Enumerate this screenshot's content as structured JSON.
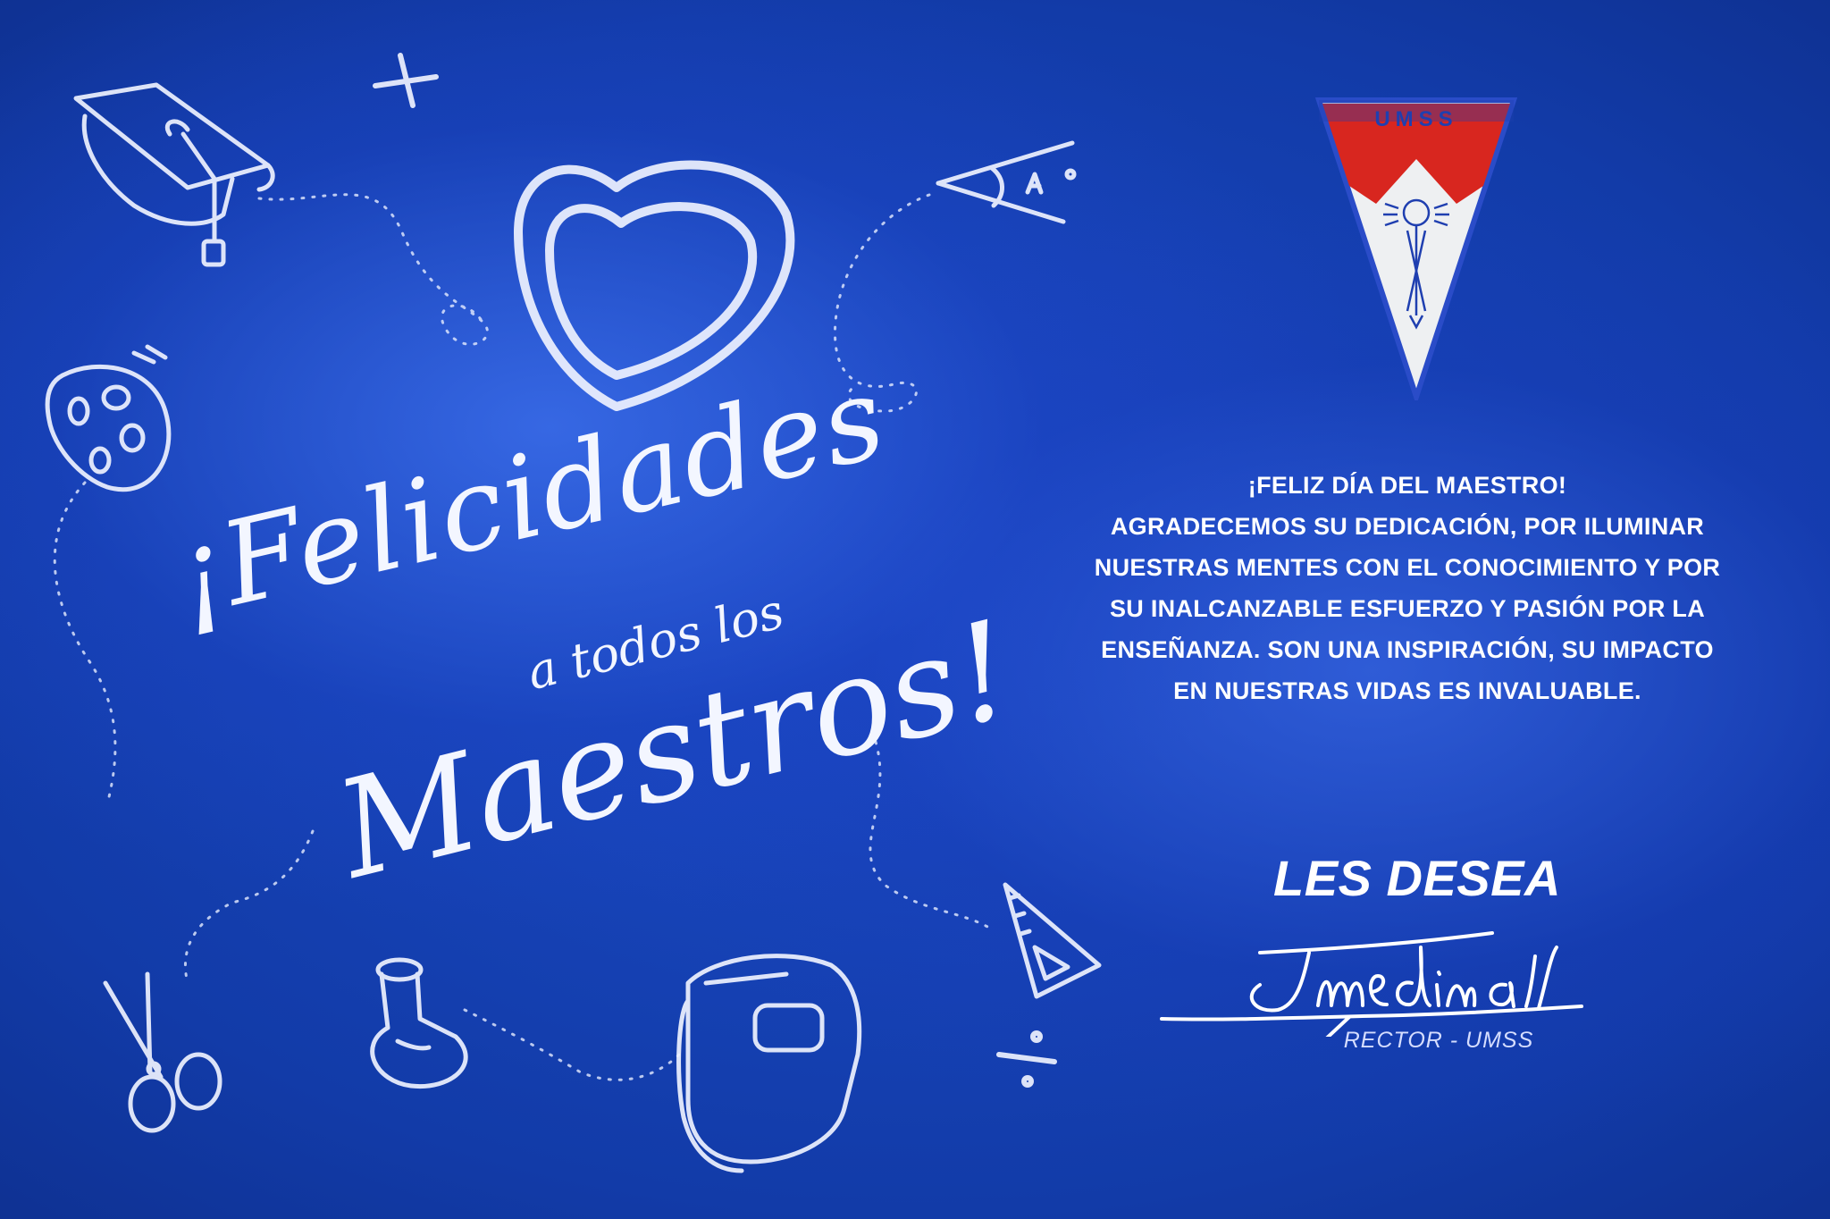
{
  "headline": {
    "felicidades": "¡Felicidades",
    "a_todos_los": "a todos los",
    "maestros": "Maestros!"
  },
  "logo": {
    "acronym": "UMSS",
    "colors": {
      "red": "#d8261f",
      "white": "#eef0f2",
      "blue": "#1f3fb0"
    }
  },
  "message": {
    "lines": [
      "¡FELIZ DÍA DEL MAESTRO!",
      "AGRADECEMOS SU DEDICACIÓN, POR ILUMINAR",
      "NUESTRAS MENTES CON EL CONOCIMIENTO Y POR",
      "SU INALCANZABLE ESFUERZO Y PASIÓN POR LA",
      "ENSEÑANZA. SON UNA INSPIRACIÓN, SU IMPACTO",
      "EN NUESTRAS VIDAS ES INVALUABLE."
    ]
  },
  "closing": {
    "les_desea": "LES DESEA",
    "signature_name": "Jmedina",
    "signer_title": "RECTOR - UMSS"
  },
  "doodles": [
    "graduation-cap-icon",
    "plus-icon",
    "heart-icon",
    "protractor-icon",
    "paint-palette-icon",
    "scissors-icon",
    "flask-icon",
    "notebook-icon",
    "triangle-ruler-icon",
    "divide-icon"
  ],
  "colors": {
    "chalkboard": "#1a47c2",
    "chalk": "#eef2ff",
    "text": "#ffffff"
  }
}
